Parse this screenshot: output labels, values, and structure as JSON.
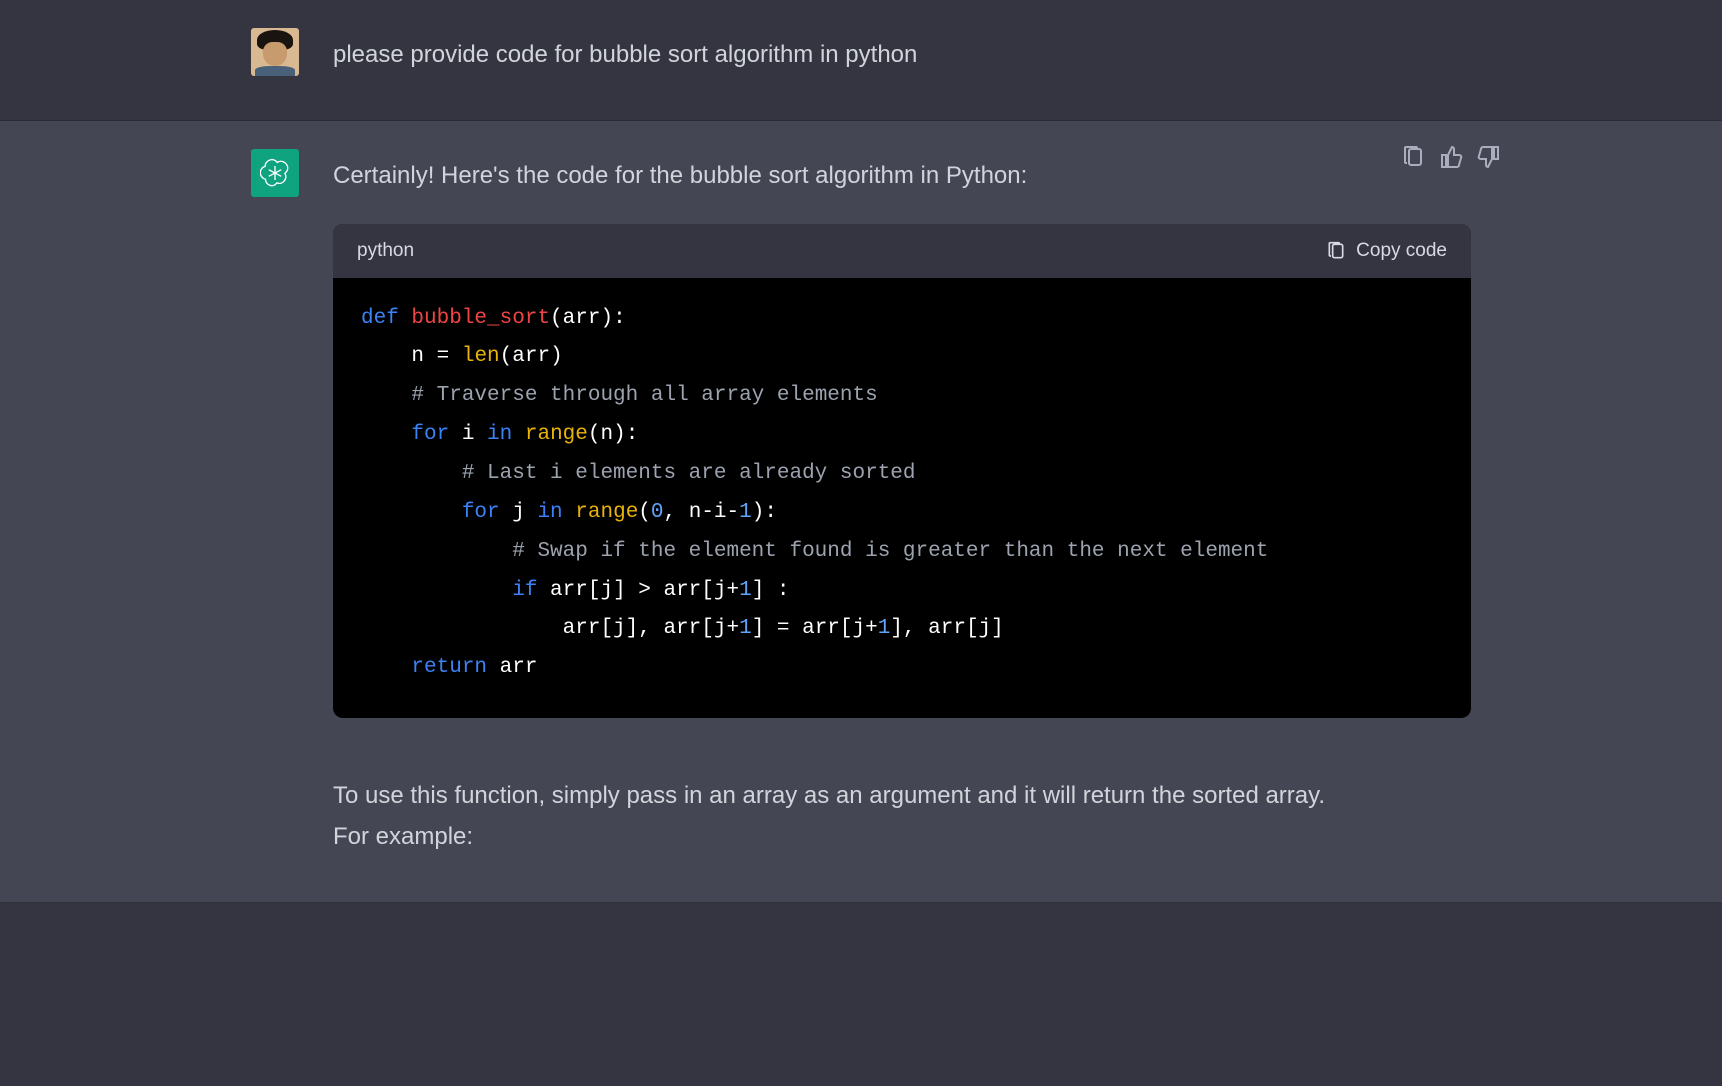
{
  "user_message": {
    "text": "please provide code for bubble sort algorithm in python"
  },
  "assistant_message": {
    "intro": "Certainly! Here's the code for the bubble sort algorithm in Python:",
    "code_lang": "python",
    "copy_label": "Copy code",
    "code": {
      "line1": {
        "def": "def",
        "fn": "bubble_sort",
        "punc1": "(",
        "arg": "arr",
        "punc2": "):"
      },
      "line2": {
        "var": "n = ",
        "builtin": "len",
        "rest": "(arr)"
      },
      "line3": {
        "comment": "# Traverse through all array elements"
      },
      "line4": {
        "kw1": "for",
        "var1": " i ",
        "kw2": "in",
        "sp": " ",
        "builtin": "range",
        "rest": "(n):"
      },
      "line5": {
        "comment": "# Last i elements are already sorted"
      },
      "line6": {
        "kw1": "for",
        "var1": " j ",
        "kw2": "in",
        "sp": " ",
        "builtin": "range",
        "punc1": "(",
        "num": "0",
        "rest": ", n-i-",
        "num2": "1",
        "punc2": "):"
      },
      "line7": {
        "comment": "# Swap if the element found is greater than the next element"
      },
      "line8": {
        "kw": "if",
        "rest1": " arr[j] > arr[j+",
        "num": "1",
        "rest2": "] :"
      },
      "line9": {
        "rest1": "arr[j], arr[j+",
        "num1": "1",
        "rest2": "] = arr[j+",
        "num2": "1",
        "rest3": "], arr[j]"
      },
      "line10": {
        "kw": "return",
        "rest": " arr"
      }
    },
    "followup1": "To use this function, simply pass in an array as an argument and it will return the sorted array.",
    "followup2": "For example:"
  },
  "icons": {
    "clipboard": "clipboard-icon",
    "thumbs_up": "thumbs-up-icon",
    "thumbs_down": "thumbs-down-icon"
  }
}
